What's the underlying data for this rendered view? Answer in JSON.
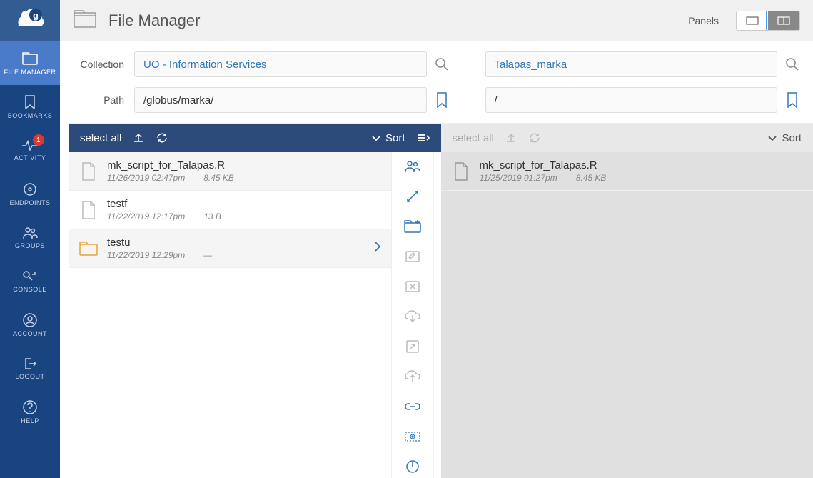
{
  "app": {
    "title": "File Manager",
    "panels_label": "Panels"
  },
  "sidebar": {
    "items": [
      {
        "label": "FILE MANAGER"
      },
      {
        "label": "BOOKMARKS"
      },
      {
        "label": "ACTIVITY",
        "badge": "1"
      },
      {
        "label": "ENDPOINTS"
      },
      {
        "label": "GROUPS"
      },
      {
        "label": "CONSOLE"
      },
      {
        "label": "ACCOUNT"
      },
      {
        "label": "LOGOUT"
      },
      {
        "label": "HELP"
      }
    ]
  },
  "labels": {
    "collection": "Collection",
    "path": "Path",
    "select_all": "select all",
    "sort": "Sort"
  },
  "left": {
    "collection": "UO - Information Services",
    "path": "/globus/marka/",
    "files": [
      {
        "name": "mk_script_for_Talapas.R",
        "date": "11/26/2019 02:47pm",
        "size": "8.45 KB",
        "type": "file"
      },
      {
        "name": "testf",
        "date": "11/22/2019 12:17pm",
        "size": "13 B",
        "type": "file"
      },
      {
        "name": "testu",
        "date": "11/22/2019 12:29pm",
        "size": "—",
        "type": "folder"
      }
    ]
  },
  "right": {
    "collection": "Talapas_marka",
    "path": "/",
    "files": [
      {
        "name": "mk_script_for_Talapas.R",
        "date": "11/25/2019 01:27pm",
        "size": "8.45 KB",
        "type": "file"
      }
    ]
  }
}
